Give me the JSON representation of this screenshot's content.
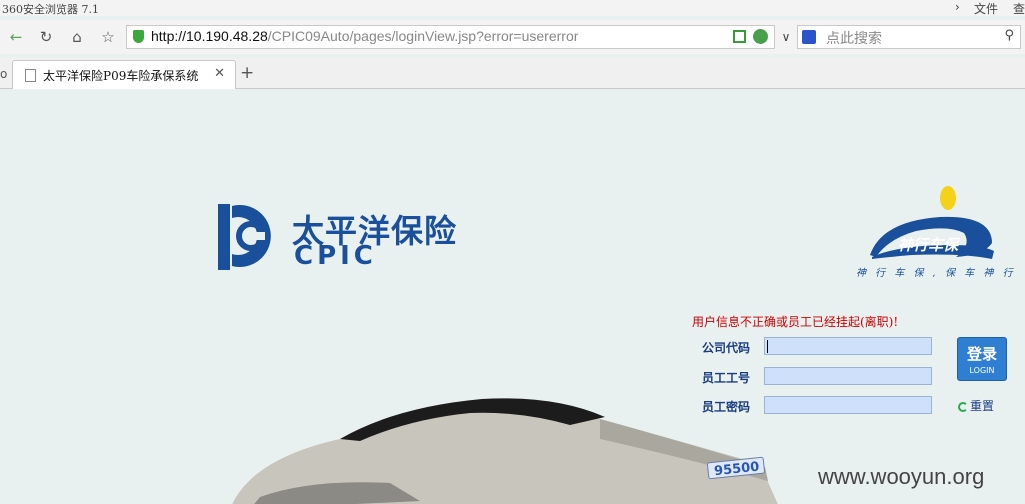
{
  "browser": {
    "title": "360安全浏览器 7.1",
    "menu_file": "文件",
    "menu_view": "查",
    "url_host": "http://10.190.48.28",
    "url_path": "/CPIC09Auto/pages/loginView.jsp?error=usererror",
    "search_placeholder": "点此搜索",
    "tab_title": "太平洋保险P09车险承保系统"
  },
  "brand": {
    "name_cn": "太平洋保险",
    "name_en": "CPIC",
    "sub_brand": "神行车保",
    "slogan": "神 行 车 保 , 保 车 神 行",
    "primary_color": "#1a4f9c"
  },
  "login": {
    "error_message": "用户信息不正确或员工已经挂起(离职)!",
    "company_code_label": "公司代码",
    "employee_id_label": "员工工号",
    "password_label": "员工密码",
    "company_code_value": "",
    "employee_id_value": "",
    "password_value": "",
    "login_button_label": "登录",
    "login_button_sub": "LOGIN",
    "reset_label": "重置"
  },
  "plate_text": "95500",
  "watermark": "www.wooyun.org"
}
